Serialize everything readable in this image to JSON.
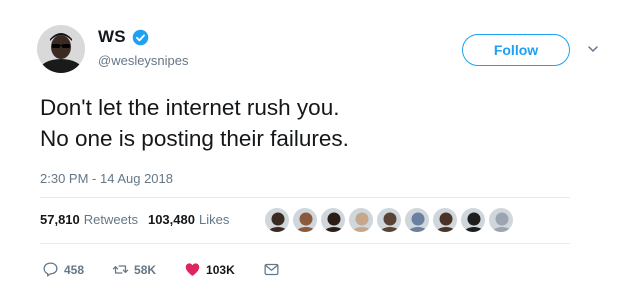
{
  "author": {
    "display_name": "WS",
    "handle": "@wesleysnipes",
    "verified": true
  },
  "follow_button": {
    "label": "Follow"
  },
  "tweet": {
    "lines": [
      "Don't let the internet rush you.",
      "No one is posting their failures."
    ],
    "timestamp": "2:30 PM - 14 Aug 2018"
  },
  "stats": {
    "retweets_count": "57,810",
    "retweets_label": "Retweets",
    "likes_count": "103,480",
    "likes_label": "Likes"
  },
  "liker_avatars": [
    "#3a2a22",
    "#8b5a3c",
    "#2b1d16",
    "#c7a78c",
    "#5a4236",
    "#6b7fa0",
    "#4a3428",
    "#1e1e1e",
    "#9aa5b1"
  ],
  "actions": {
    "reply_count": "458",
    "retweet_count": "58K",
    "like_count": "103K"
  },
  "colors": {
    "accent": "#1da1f2",
    "like": "#e0245e",
    "muted": "#657786",
    "text": "#14171a"
  },
  "icons": {
    "verified": "verified-badge-icon",
    "caret": "chevron-down-icon",
    "reply": "reply-icon",
    "retweet": "retweet-icon",
    "like": "heart-icon",
    "dm": "envelope-icon"
  }
}
